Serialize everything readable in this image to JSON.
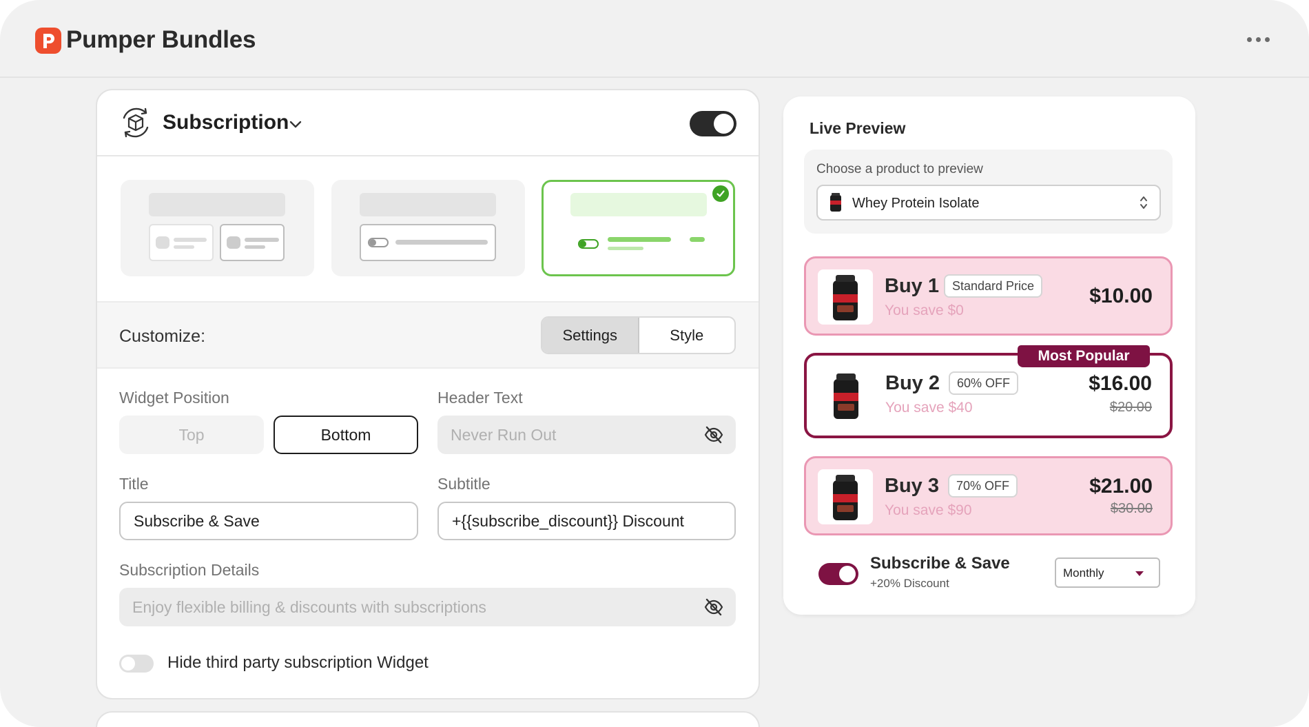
{
  "app": {
    "title": "Pumper Bundles"
  },
  "widget": {
    "title": "Subscription",
    "enabled": true
  },
  "customize": {
    "label": "Customize:",
    "tabs": [
      "Settings",
      "Style"
    ],
    "active_tab": "Settings"
  },
  "form": {
    "widget_position": {
      "label": "Widget Position",
      "options": [
        "Top",
        "Bottom"
      ],
      "selected": "Bottom"
    },
    "header_text": {
      "label": "Header Text",
      "value": "Never Run Out"
    },
    "title": {
      "label": "Title",
      "value": "Subscribe & Save"
    },
    "subtitle": {
      "label": "Subtitle",
      "value": "+{{subscribe_discount}} Discount"
    },
    "details": {
      "label": "Subscription Details",
      "value": "Enjoy flexible billing & discounts with subscriptions"
    },
    "hide_third_party": {
      "label": "Hide third party subscription Widget",
      "enabled": false
    }
  },
  "preview": {
    "title": "Live Preview",
    "chooser_label": "Choose a product to preview",
    "product": "Whey Protein Isolate",
    "offers": [
      {
        "label": "Buy 1",
        "tag": "Standard Price",
        "save": "You save $0",
        "price": "$10.00",
        "old_price": ""
      },
      {
        "label": "Buy 2",
        "tag": "60% OFF",
        "save": "You save $40",
        "price": "$16.00",
        "old_price": "$20.00",
        "badge": "Most Popular"
      },
      {
        "label": "Buy 3",
        "tag": "70% OFF",
        "save": "You save $90",
        "price": "$21.00",
        "old_price": "$30.00"
      }
    ],
    "subscribe": {
      "title": "Subscribe & Save",
      "subtitle": "+20% Discount",
      "frequency": "Monthly",
      "enabled": true
    }
  },
  "colors": {
    "accent": "#7e1243",
    "pink_bg": "#fadbe4",
    "green": "#3fa324",
    "logo": "#ee4e2e"
  },
  "icons": [
    "logo-icon",
    "more-icon",
    "subscription-icon",
    "chevron-down-icon",
    "check-icon",
    "eye-off-icon",
    "up-down-icon",
    "caret-down-icon"
  ]
}
